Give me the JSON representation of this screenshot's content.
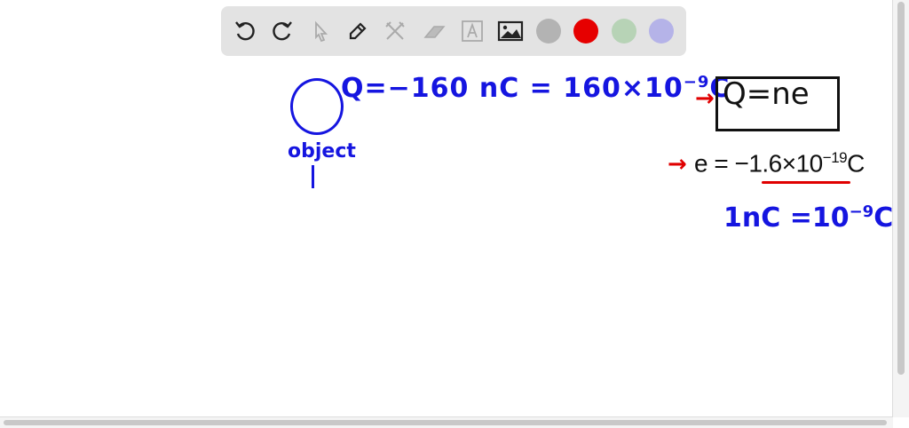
{
  "toolbar": {
    "tools": [
      "undo-icon",
      "redo-icon",
      "select-icon",
      "pen-icon",
      "tools-icon",
      "eraser-icon",
      "text-icon",
      "image-icon"
    ],
    "colors": [
      "#b3b3b3",
      "#e60000",
      "#b7d3b6",
      "#b5b3e8"
    ]
  },
  "canvas": {
    "charge_eq": "Q=−160 nC = 160×10",
    "charge_exp": "−9",
    "charge_unit": "C",
    "object_label": "object",
    "formula": "Q=ne",
    "e_eq": "e = −1.6×10",
    "e_exp": "−19",
    "e_unit": "C",
    "nc_eq": "1nC =10",
    "nc_exp": "−9",
    "nc_unit": "C",
    "ink_blue": "#1515e0",
    "ink_red": "#e00000"
  }
}
